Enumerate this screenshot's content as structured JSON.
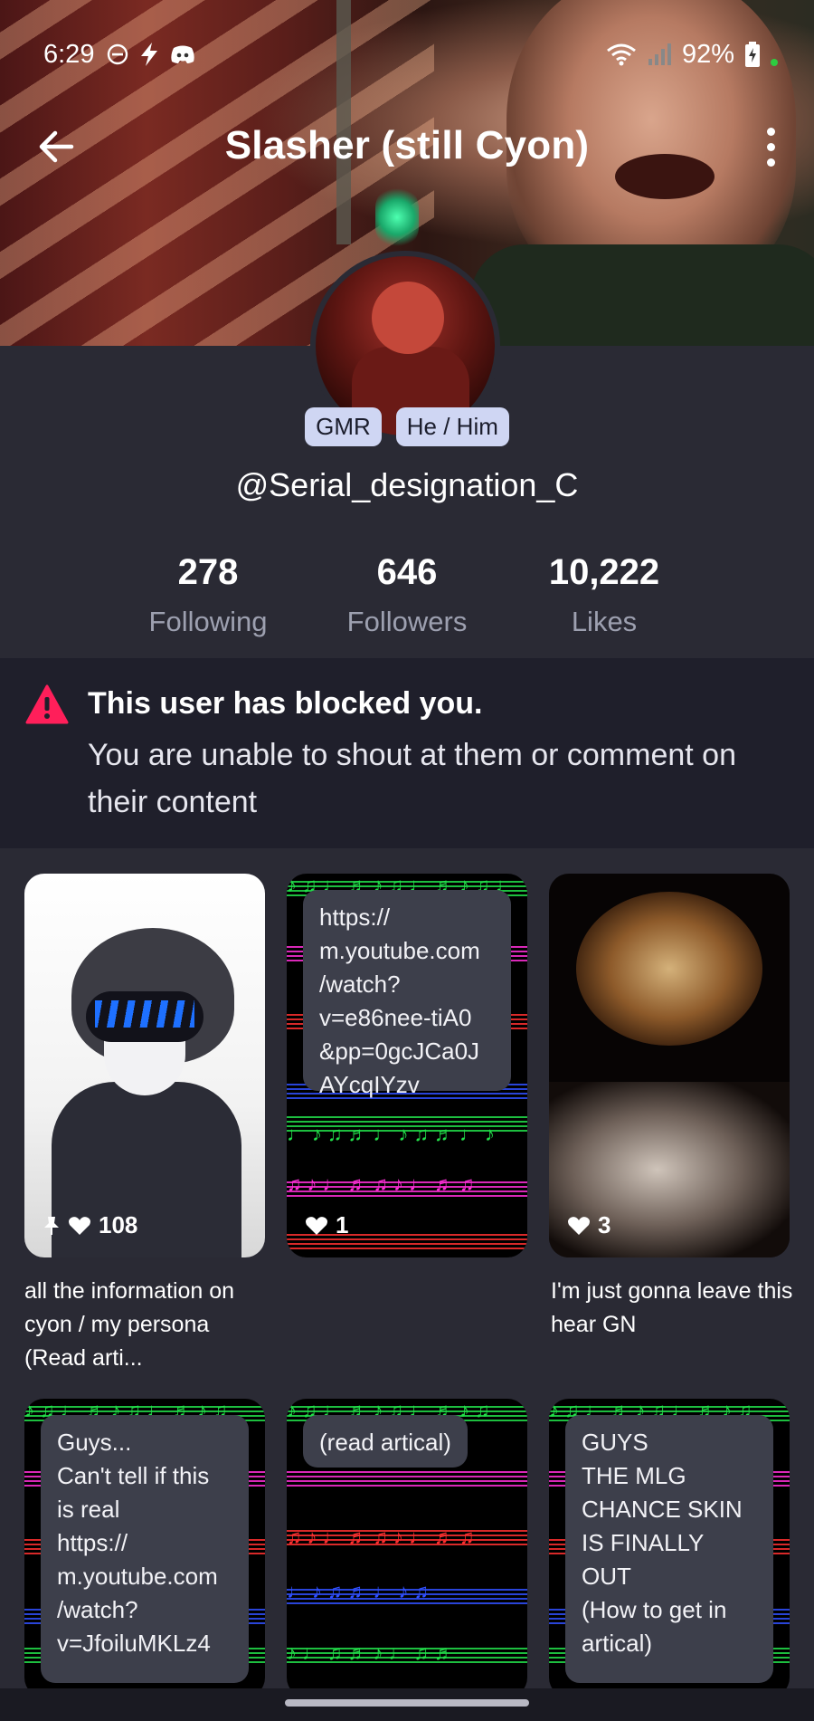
{
  "status_bar": {
    "time": "6:29",
    "battery": "92%"
  },
  "header": {
    "title": "Slasher (still Cyon)"
  },
  "profile": {
    "tags": [
      "GMR",
      "He / Him"
    ],
    "username": "@Serial_designation_C",
    "stats": [
      {
        "value": "278",
        "label": "Following"
      },
      {
        "value": "646",
        "label": "Followers"
      },
      {
        "value": "10,222",
        "label": "Likes"
      }
    ]
  },
  "blocked": {
    "title": "This user has blocked you.",
    "message": "You are unable to shout at them or comment on their content"
  },
  "posts": [
    {
      "likes": "108",
      "pinned": true,
      "caption": "all the information on cyon / my persona (Read arti...",
      "kind": "image"
    },
    {
      "likes": "1",
      "pinned": false,
      "text": "https://\nm.youtube.com\n/watch?\nv=e86nee-tiA0\n&pp=0gcJCa0J\nAYcqIYzv",
      "kind": "text"
    },
    {
      "likes": "3",
      "pinned": false,
      "caption": "I'm just gonna leave this hear GN",
      "kind": "image"
    },
    {
      "text": "Guys...\nCan't tell if this is real\nhttps://\nm.youtube.com\n/watch?\nv=JfoiluMKLz4",
      "kind": "text"
    },
    {
      "text": "(read artical)",
      "kind": "text"
    },
    {
      "text": "GUYS\nTHE MLG\nCHANCE SKIN\nIS FINALLY\nOUT\n(How to get in\nartical)",
      "kind": "text"
    }
  ],
  "colors": {
    "background": "#2a2a34",
    "blocked_bg": "#1f1f2b",
    "warning": "#ff1f5a",
    "pill": "#cfd6f3",
    "muted": "#9da0b0"
  }
}
